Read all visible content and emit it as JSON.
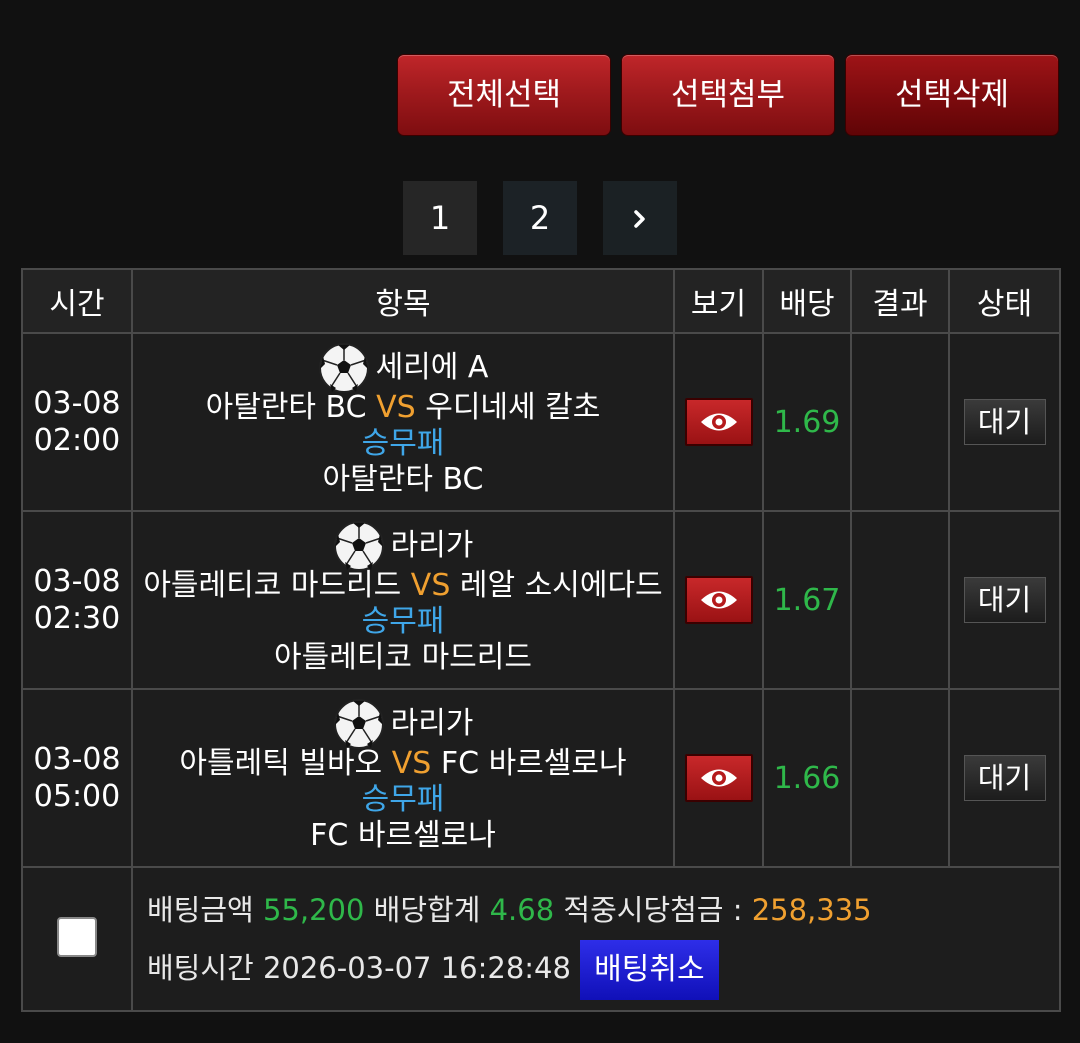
{
  "toolbar": {
    "select_all": "전체선택",
    "attach_selected": "선택첨부",
    "delete_selected": "선택삭제"
  },
  "pagination": {
    "pages": [
      "1",
      "2"
    ],
    "next_icon": "chevron-right-icon",
    "current": "2"
  },
  "table": {
    "headers": {
      "time": "시간",
      "item": "항목",
      "view": "보기",
      "odds": "배당",
      "result": "결과",
      "status": "상태"
    },
    "rows": [
      {
        "date": "03-08",
        "time": "02:00",
        "sport_icon": "soccer-ball-icon",
        "league": "세리에 A",
        "home": "아탈란타 BC",
        "vs": "VS",
        "away": "우디네세 칼초",
        "market": "승무패",
        "pick": "아탈란타 BC",
        "odds": "1.69",
        "result": "",
        "status": "대기"
      },
      {
        "date": "03-08",
        "time": "02:30",
        "sport_icon": "soccer-ball-icon",
        "league": "라리가",
        "home": "아틀레티코 마드리드",
        "vs": "VS",
        "away": "레알 소시에다드",
        "market": "승무패",
        "pick": "아틀레티코 마드리드",
        "odds": "1.67",
        "result": "",
        "status": "대기"
      },
      {
        "date": "03-08",
        "time": "05:00",
        "sport_icon": "soccer-ball-icon",
        "league": "라리가",
        "home": "아틀레틱 빌바오",
        "vs": "VS",
        "away": "FC 바르셀로나",
        "market": "승무패",
        "pick": "FC 바르셀로나",
        "odds": "1.66",
        "result": "",
        "status": "대기"
      }
    ]
  },
  "summary": {
    "bet_amount_label": "배팅금액",
    "bet_amount": "55,200",
    "total_odds_label": "배당합계",
    "total_odds": "4.68",
    "payout_label": "적중시당첨금 :",
    "payout": "258,335",
    "bet_time_label": "배팅시간",
    "bet_time": "2026-03-07 16:28:48",
    "cancel_label": "배팅취소"
  },
  "colors": {
    "background": "#111111",
    "odds_green": "#2fb84a",
    "vs_orange": "#f0a030",
    "market_blue": "#3fa6e8",
    "button_red": "#a01a1d",
    "cancel_blue": "#1a1ad0"
  }
}
